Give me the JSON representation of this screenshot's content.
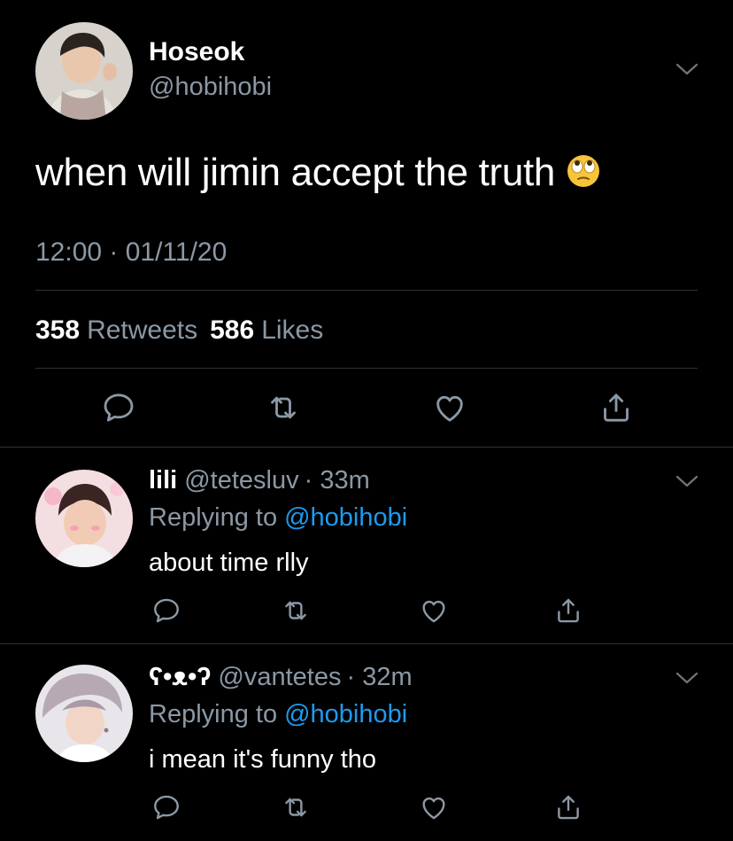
{
  "main_tweet": {
    "display_name": "Hoseok",
    "handle": "@hobihobi",
    "text": "when will jimin accept the truth",
    "emoji": "eye-roll-emoji",
    "timestamp": "12:00 · 01/11/20",
    "retweets_count": "358",
    "retweets_label": "Retweets",
    "likes_count": "586",
    "likes_label": "Likes"
  },
  "replies": [
    {
      "display_name": "lili",
      "handle": "@tetesluv",
      "time": "· 33m",
      "replying_prefix": "Replying to",
      "replying_to": "@hobihobi",
      "text": "about time rlly"
    },
    {
      "display_name": "ʕ•ᴥ•ʔ",
      "handle": "@vantetes",
      "time": "· 32m",
      "replying_prefix": "Replying to",
      "replying_to": "@hobihobi",
      "text": "i mean it's funny tho"
    }
  ],
  "colors": {
    "background": "#000000",
    "text_primary": "#ffffff",
    "text_secondary": "#8b98a5",
    "link": "#1d9bf0",
    "divider": "#2f3336"
  },
  "icons": [
    "chevron-down-icon",
    "reply-icon",
    "retweet-icon",
    "like-icon",
    "share-icon"
  ]
}
